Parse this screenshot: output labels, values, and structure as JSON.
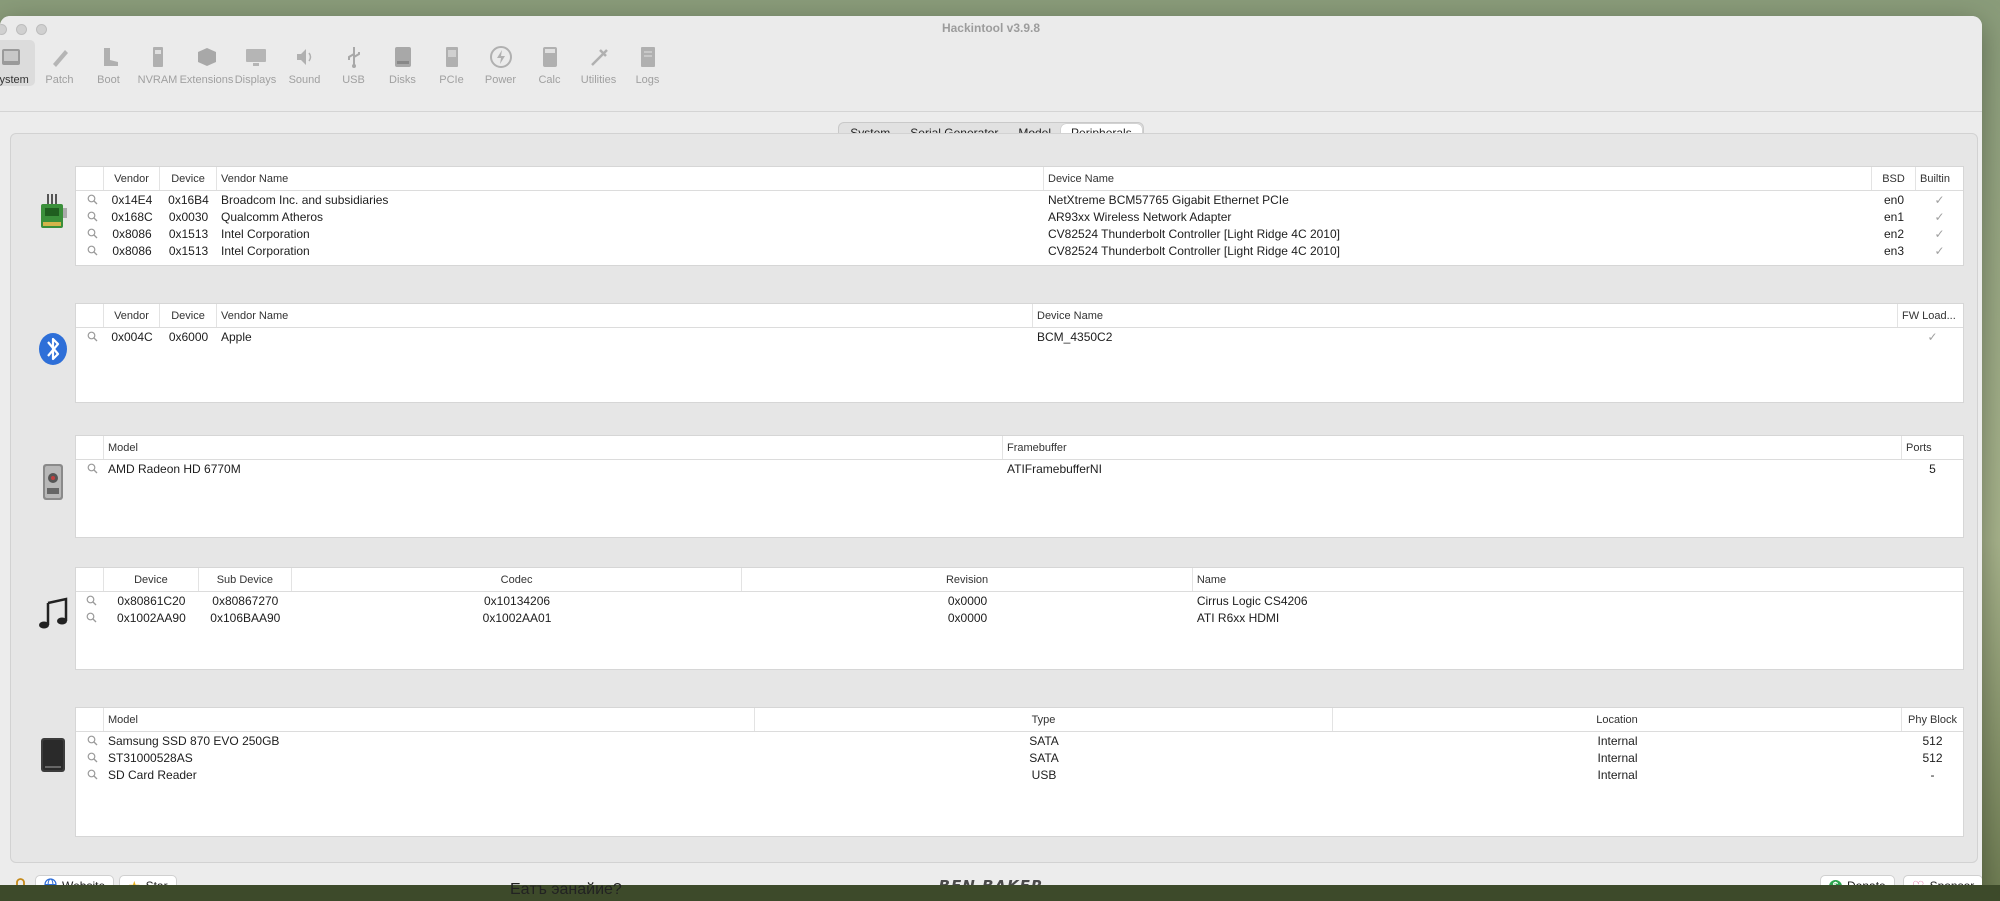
{
  "window": {
    "title": "Hackintool v3.9.8"
  },
  "toolbar": {
    "items": [
      {
        "label": "System",
        "icon": "system-icon"
      },
      {
        "label": "Patch",
        "icon": "patch-icon"
      },
      {
        "label": "Boot",
        "icon": "boot-icon"
      },
      {
        "label": "NVRAM",
        "icon": "nvram-icon"
      },
      {
        "label": "Extensions",
        "icon": "extensions-icon"
      },
      {
        "label": "Displays",
        "icon": "displays-icon"
      },
      {
        "label": "Sound",
        "icon": "sound-icon"
      },
      {
        "label": "USB",
        "icon": "usb-icon"
      },
      {
        "label": "Disks",
        "icon": "disks-icon"
      },
      {
        "label": "PCIe",
        "icon": "pcie-icon"
      },
      {
        "label": "Power",
        "icon": "power-icon"
      },
      {
        "label": "Calc",
        "icon": "calc-icon"
      },
      {
        "label": "Utilities",
        "icon": "utilities-icon"
      },
      {
        "label": "Logs",
        "icon": "logs-icon"
      }
    ],
    "active": "System"
  },
  "tabs": {
    "items": [
      "System",
      "Serial Generator",
      "Model",
      "Peripherals"
    ],
    "selected": "Peripherals"
  },
  "network": {
    "headers": [
      "Vendor",
      "Device",
      "Vendor Name",
      "Device Name",
      "BSD",
      "Builtin"
    ],
    "rows": [
      [
        "0x14E4",
        "0x16B4",
        "Broadcom Inc. and subsidiaries",
        "NetXtreme BCM57765 Gigabit Ethernet PCIe",
        "en0",
        "✓"
      ],
      [
        "0x168C",
        "0x0030",
        "Qualcomm Atheros",
        "AR93xx Wireless Network Adapter",
        "en1",
        "✓"
      ],
      [
        "0x8086",
        "0x1513",
        "Intel Corporation",
        "CV82524 Thunderbolt Controller [Light Ridge 4C 2010]",
        "en2",
        "✓"
      ],
      [
        "0x8086",
        "0x1513",
        "Intel Corporation",
        "CV82524 Thunderbolt Controller [Light Ridge 4C 2010]",
        "en3",
        "✓"
      ]
    ]
  },
  "bluetooth": {
    "headers": [
      "Vendor",
      "Device",
      "Vendor Name",
      "Device Name",
      "FW Load..."
    ],
    "rows": [
      [
        "0x004C",
        "0x6000",
        "Apple",
        "BCM_4350C2",
        "✓"
      ]
    ]
  },
  "graphics": {
    "headers": [
      "Model",
      "Framebuffer",
      "Ports"
    ],
    "rows": [
      [
        "AMD Radeon HD 6770M",
        "ATIFramebufferNI",
        "5"
      ]
    ]
  },
  "audio": {
    "headers": [
      "Device",
      "Sub Device",
      "Codec",
      "Revision",
      "Name"
    ],
    "rows": [
      [
        "0x80861C20",
        "0x80867270",
        "0x10134206",
        "0x0000",
        "Cirrus Logic CS4206"
      ],
      [
        "0x1002AA90",
        "0x106BAA90",
        "0x1002AA01",
        "0x0000",
        "ATI R6xx HDMI"
      ]
    ]
  },
  "storage": {
    "headers": [
      "Model",
      "Type",
      "Location",
      "Phy Block"
    ],
    "rows": [
      [
        "Samsung SSD 870 EVO 250GB",
        "SATA",
        "Internal",
        "512"
      ],
      [
        "ST31000528AS",
        "SATA",
        "Internal",
        "512"
      ],
      [
        "SD Card Reader",
        "USB",
        "Internal",
        "-"
      ]
    ]
  },
  "footer": {
    "website": "Website",
    "star": "Star",
    "brand": "BEN BAKER",
    "donate": "Donate",
    "sponsor": "Sponsor"
  },
  "background_text": "Eaтъ эанайие?"
}
